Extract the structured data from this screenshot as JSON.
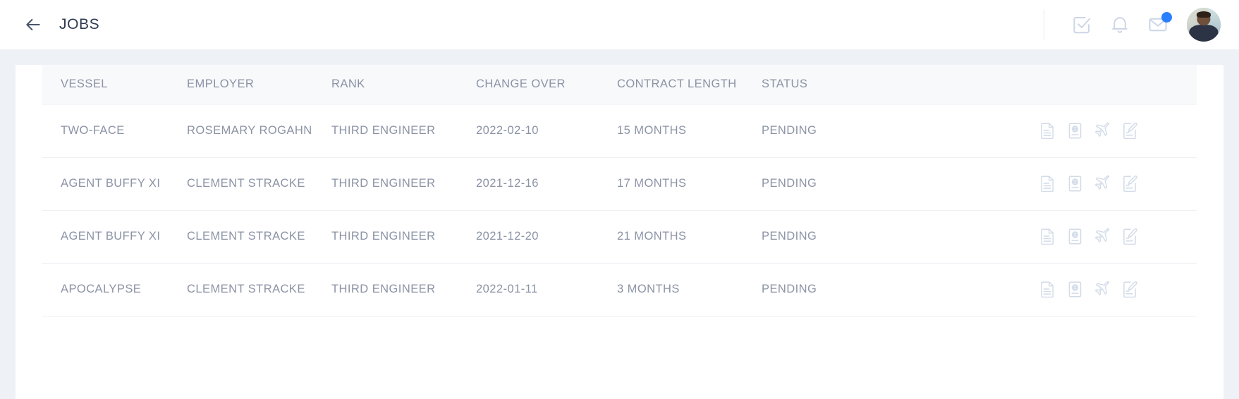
{
  "header": {
    "title": "JOBS",
    "back_icon": "arrow-left-icon",
    "actions": [
      {
        "icon": "checkbox-task-icon",
        "badge": null
      },
      {
        "icon": "bell-notification-icon",
        "badge": null
      },
      {
        "icon": "envelope-mail-icon",
        "badge": "unread"
      }
    ],
    "avatar_label": "user-avatar",
    "accent_color": "#2a7fff",
    "title_color": "#2f3b52"
  },
  "table": {
    "columns": [
      "VESSEL",
      "EMPLOYER",
      "RANK",
      "CHANGE OVER",
      "CONTRACT LENGTH",
      "STATUS"
    ],
    "row_action_icons": [
      "document-icon",
      "passport-icon",
      "airplane-icon",
      "edit-document-icon"
    ],
    "text_color": "#8b93a5",
    "header_bg": "#f8f9fb",
    "rows": [
      {
        "vessel": "TWO-FACE",
        "employer": "ROSEMARY ROGAHN",
        "rank": "THIRD ENGINEER",
        "change_over": "2022-02-10",
        "contract_length": "15 MONTHS",
        "status": "PENDING"
      },
      {
        "vessel": "AGENT BUFFY XI",
        "employer": "CLEMENT STRACKE",
        "rank": "THIRD ENGINEER",
        "change_over": "2021-12-16",
        "contract_length": "17 MONTHS",
        "status": "PENDING"
      },
      {
        "vessel": "AGENT BUFFY XI",
        "employer": "CLEMENT STRACKE",
        "rank": "THIRD ENGINEER",
        "change_over": "2021-12-20",
        "contract_length": "21 MONTHS",
        "status": "PENDING"
      },
      {
        "vessel": "APOCALYPSE",
        "employer": "CLEMENT STRACKE",
        "rank": "THIRD ENGINEER",
        "change_over": "2022-01-11",
        "contract_length": "3 MONTHS",
        "status": "PENDING"
      }
    ]
  }
}
